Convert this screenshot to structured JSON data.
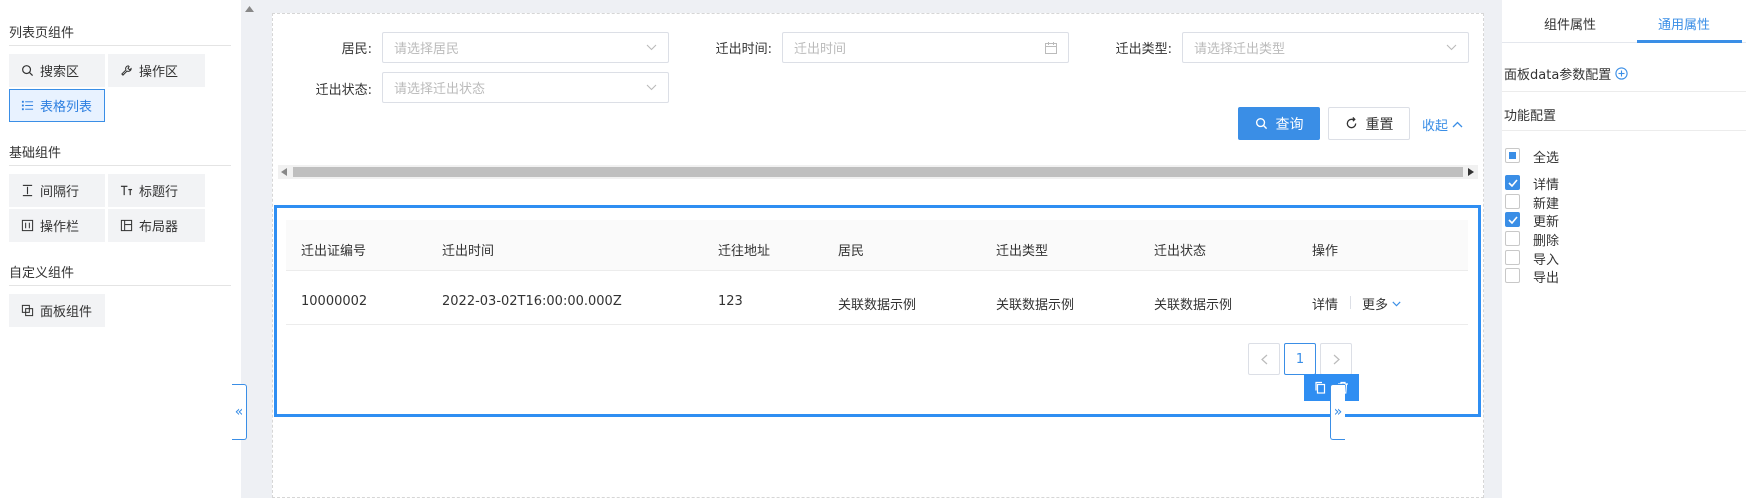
{
  "left_panel": {
    "sections": [
      {
        "title": "列表页组件",
        "items": [
          "搜索区",
          "操作区",
          "表格列表"
        ]
      },
      {
        "title": "基础组件",
        "items": [
          "间隔行",
          "标题行",
          "操作栏",
          "布局器"
        ]
      },
      {
        "title": "自定义组件",
        "items": [
          "面板组件"
        ]
      }
    ],
    "active_item": "表格列表"
  },
  "search": {
    "fields": [
      {
        "label": "居民:",
        "placeholder": "请选择居民"
      },
      {
        "label": "迁出时间:",
        "placeholder": "迁出时间"
      },
      {
        "label": "迁出类型:",
        "placeholder": "请选择迁出类型"
      },
      {
        "label": "迁出状态:",
        "placeholder": "请选择迁出状态"
      }
    ],
    "query_label": "查询",
    "reset_label": "重置",
    "collapse_label": "收起"
  },
  "table": {
    "columns": [
      "迁出证编号",
      "迁出时间",
      "迁往地址",
      "居民",
      "迁出类型",
      "迁出状态",
      "操作"
    ],
    "rows": [
      [
        "10000002",
        "2022-03-02T16:00:00.000Z",
        "123",
        "关联数据示例",
        "关联数据示例",
        "关联数据示例"
      ]
    ],
    "row_actions": {
      "detail": "详情",
      "more": "更多"
    },
    "pagination": {
      "current_page": "1"
    }
  },
  "nav_arrows": {
    "left": "«",
    "right": "»"
  },
  "right_panel": {
    "tabs": [
      "组件属性",
      "通用属性"
    ],
    "active_tab": "通用属性",
    "data_config_label": "面板data参数配置",
    "feature_config_label": "功能配置",
    "select_all_label": "全选",
    "options": [
      {
        "label": "详情",
        "checked": true
      },
      {
        "label": "新建",
        "checked": false
      },
      {
        "label": "更新",
        "checked": true
      },
      {
        "label": "删除",
        "checked": false
      },
      {
        "label": "导入",
        "checked": false
      },
      {
        "label": "导出",
        "checked": false
      }
    ]
  },
  "colors": {
    "accent": "#3a8ee6",
    "panel_border": "#2f8ef2",
    "canvas_bg": "#eef0f4"
  }
}
